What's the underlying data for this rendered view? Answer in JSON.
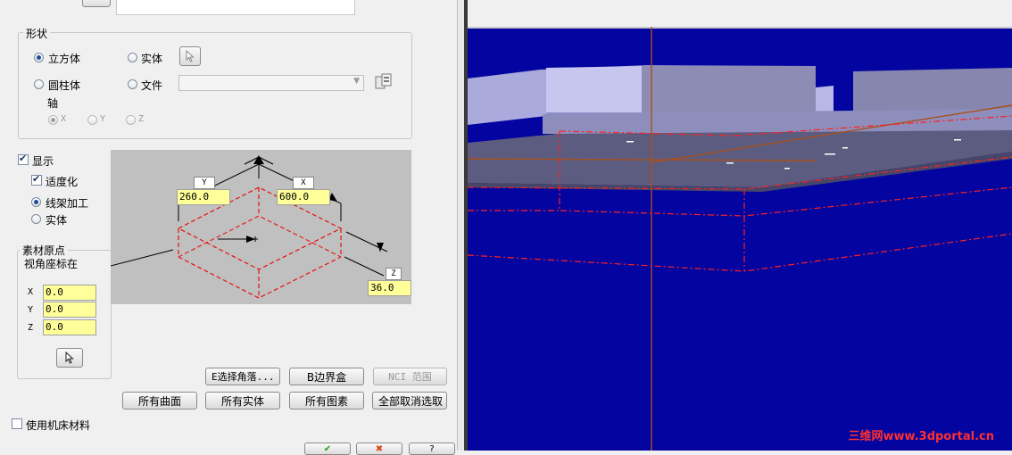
{
  "shape_group": {
    "title": "形状",
    "cube_label": "立方体",
    "solid_label": "实体",
    "cylinder_label": "圆柱体",
    "file_label": "文件",
    "axis_label": "轴",
    "axis_x": "X",
    "axis_y": "Y",
    "axis_z": "Z"
  },
  "display": {
    "display_label": "显示",
    "fit_label": "适度化",
    "wireframe_label": "线架加工",
    "solid_label": "实体"
  },
  "origin_group": {
    "title": "素材原点",
    "subtitle": "视角座标在",
    "x_label": "X",
    "y_label": "Y",
    "z_label": "Z",
    "x_value": "0.0",
    "y_value": "0.0",
    "z_value": "0.0"
  },
  "diagram": {
    "y_tag": "Y",
    "y_value": "260.0",
    "x_tag": "X",
    "x_value": "600.0",
    "z_tag": "Z",
    "z_value": "36.0"
  },
  "buttons": {
    "select_corner": "E选择角落...",
    "bounding_box": "B边界盒",
    "nci_range": "NCI 范围",
    "all_surfaces": "所有曲面",
    "all_solids": "所有实体",
    "all_entities": "所有图素",
    "deselect_all": "全部取消选取"
  },
  "machine_material_label": "使用机床材料",
  "watermark": "三维网www.3dportal.cn",
  "colors": {
    "viewport_bg": "#0404a0",
    "field_yellow": "#ffff9a",
    "stock_red": "#ff2020"
  }
}
